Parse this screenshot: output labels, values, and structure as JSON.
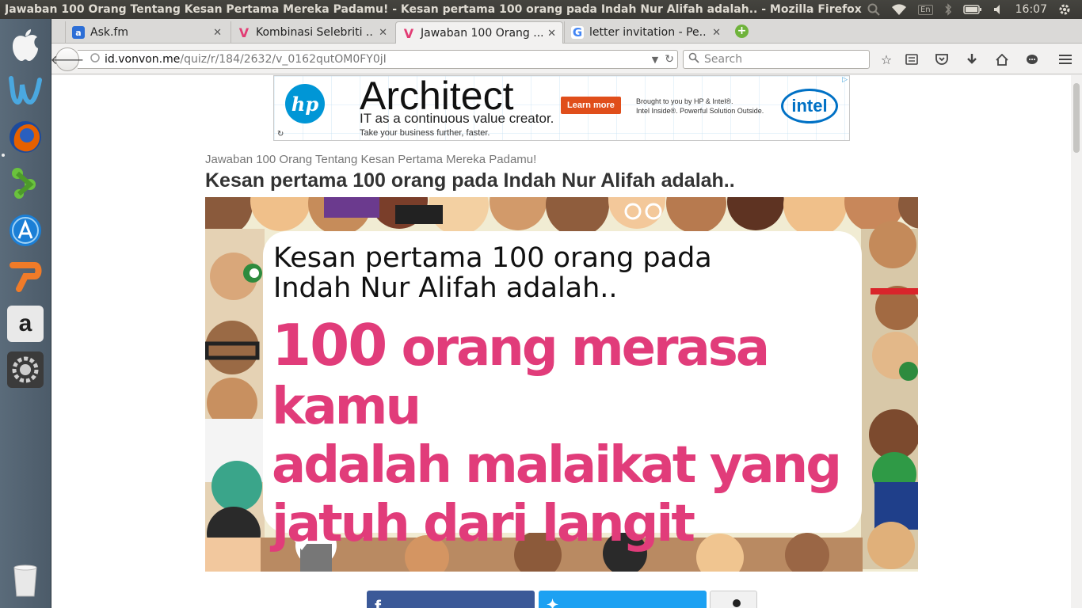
{
  "window": {
    "title": "Jawaban 100 Orang Tentang Kesan Pertama Mereka Padamu! - Kesan pertama 100 orang pada Indah Nur Alifah adalah.. - Mozilla Firefox"
  },
  "system": {
    "keyboard_layout": "En",
    "clock": "16:07"
  },
  "tabs": [
    {
      "label": "Ask.fm",
      "favicon": "askfm-icon",
      "color": "#2c6ed6"
    },
    {
      "label": "Kombinasi Selebriti ...",
      "favicon": "vonvon-icon",
      "color": "#e23c74"
    },
    {
      "label": "Jawaban 100 Orang ...",
      "favicon": "vonvon-icon",
      "color": "#e23c74"
    },
    {
      "label": "letter invitation - Pe...",
      "favicon": "google-icon",
      "color": "#4285f4"
    }
  ],
  "address": {
    "host": "id.vonvon.me",
    "path": "/quiz/r/184/2632/v_0162qutOM0FY0jI"
  },
  "search": {
    "placeholder": "Search"
  },
  "ad": {
    "headline": "Architect",
    "subline": "IT as a continuous value creator.",
    "tagline": "Take your business further, faster.",
    "cta": "Learn more",
    "byline1": "Brought to you by HP & Intel®.",
    "byline2": "Intel Inside®. Powerful Solution Outside.",
    "brand_left": "hp",
    "brand_right": "intel"
  },
  "page": {
    "breadcrumb": "Jawaban 100 Orang Tentang Kesan Pertama Mereka Padamu!",
    "title": "Kesan pertama 100 orang pada Indah Nur Alifah adalah..",
    "result_intro_1": "Kesan pertama 100 orang pada",
    "result_intro_2": "Indah Nur Alifah adalah..",
    "result_number": "100",
    "result_text_1": " orang merasa kamu",
    "result_text_2": "adalah malaikat yang",
    "result_text_3": "jatuh dari langit",
    "accent_color": "#e13c7a"
  }
}
